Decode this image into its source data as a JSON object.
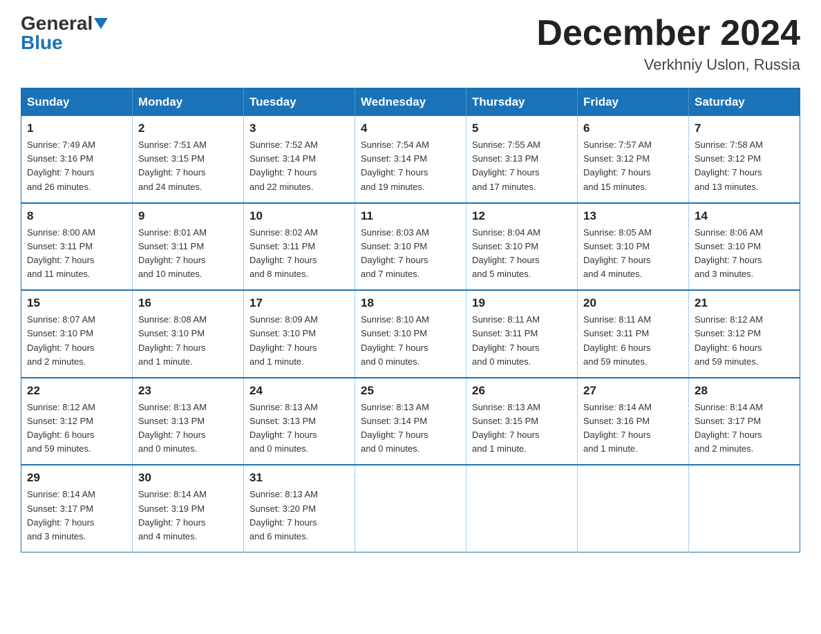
{
  "header": {
    "logo_general": "General",
    "logo_blue": "Blue",
    "month_title": "December 2024",
    "location": "Verkhniy Uslon, Russia"
  },
  "calendar": {
    "days_of_week": [
      "Sunday",
      "Monday",
      "Tuesday",
      "Wednesday",
      "Thursday",
      "Friday",
      "Saturday"
    ],
    "weeks": [
      [
        {
          "day": "1",
          "info": "Sunrise: 7:49 AM\nSunset: 3:16 PM\nDaylight: 7 hours\nand 26 minutes."
        },
        {
          "day": "2",
          "info": "Sunrise: 7:51 AM\nSunset: 3:15 PM\nDaylight: 7 hours\nand 24 minutes."
        },
        {
          "day": "3",
          "info": "Sunrise: 7:52 AM\nSunset: 3:14 PM\nDaylight: 7 hours\nand 22 minutes."
        },
        {
          "day": "4",
          "info": "Sunrise: 7:54 AM\nSunset: 3:14 PM\nDaylight: 7 hours\nand 19 minutes."
        },
        {
          "day": "5",
          "info": "Sunrise: 7:55 AM\nSunset: 3:13 PM\nDaylight: 7 hours\nand 17 minutes."
        },
        {
          "day": "6",
          "info": "Sunrise: 7:57 AM\nSunset: 3:12 PM\nDaylight: 7 hours\nand 15 minutes."
        },
        {
          "day": "7",
          "info": "Sunrise: 7:58 AM\nSunset: 3:12 PM\nDaylight: 7 hours\nand 13 minutes."
        }
      ],
      [
        {
          "day": "8",
          "info": "Sunrise: 8:00 AM\nSunset: 3:11 PM\nDaylight: 7 hours\nand 11 minutes."
        },
        {
          "day": "9",
          "info": "Sunrise: 8:01 AM\nSunset: 3:11 PM\nDaylight: 7 hours\nand 10 minutes."
        },
        {
          "day": "10",
          "info": "Sunrise: 8:02 AM\nSunset: 3:11 PM\nDaylight: 7 hours\nand 8 minutes."
        },
        {
          "day": "11",
          "info": "Sunrise: 8:03 AM\nSunset: 3:10 PM\nDaylight: 7 hours\nand 7 minutes."
        },
        {
          "day": "12",
          "info": "Sunrise: 8:04 AM\nSunset: 3:10 PM\nDaylight: 7 hours\nand 5 minutes."
        },
        {
          "day": "13",
          "info": "Sunrise: 8:05 AM\nSunset: 3:10 PM\nDaylight: 7 hours\nand 4 minutes."
        },
        {
          "day": "14",
          "info": "Sunrise: 8:06 AM\nSunset: 3:10 PM\nDaylight: 7 hours\nand 3 minutes."
        }
      ],
      [
        {
          "day": "15",
          "info": "Sunrise: 8:07 AM\nSunset: 3:10 PM\nDaylight: 7 hours\nand 2 minutes."
        },
        {
          "day": "16",
          "info": "Sunrise: 8:08 AM\nSunset: 3:10 PM\nDaylight: 7 hours\nand 1 minute."
        },
        {
          "day": "17",
          "info": "Sunrise: 8:09 AM\nSunset: 3:10 PM\nDaylight: 7 hours\nand 1 minute."
        },
        {
          "day": "18",
          "info": "Sunrise: 8:10 AM\nSunset: 3:10 PM\nDaylight: 7 hours\nand 0 minutes."
        },
        {
          "day": "19",
          "info": "Sunrise: 8:11 AM\nSunset: 3:11 PM\nDaylight: 7 hours\nand 0 minutes."
        },
        {
          "day": "20",
          "info": "Sunrise: 8:11 AM\nSunset: 3:11 PM\nDaylight: 6 hours\nand 59 minutes."
        },
        {
          "day": "21",
          "info": "Sunrise: 8:12 AM\nSunset: 3:12 PM\nDaylight: 6 hours\nand 59 minutes."
        }
      ],
      [
        {
          "day": "22",
          "info": "Sunrise: 8:12 AM\nSunset: 3:12 PM\nDaylight: 6 hours\nand 59 minutes."
        },
        {
          "day": "23",
          "info": "Sunrise: 8:13 AM\nSunset: 3:13 PM\nDaylight: 7 hours\nand 0 minutes."
        },
        {
          "day": "24",
          "info": "Sunrise: 8:13 AM\nSunset: 3:13 PM\nDaylight: 7 hours\nand 0 minutes."
        },
        {
          "day": "25",
          "info": "Sunrise: 8:13 AM\nSunset: 3:14 PM\nDaylight: 7 hours\nand 0 minutes."
        },
        {
          "day": "26",
          "info": "Sunrise: 8:13 AM\nSunset: 3:15 PM\nDaylight: 7 hours\nand 1 minute."
        },
        {
          "day": "27",
          "info": "Sunrise: 8:14 AM\nSunset: 3:16 PM\nDaylight: 7 hours\nand 1 minute."
        },
        {
          "day": "28",
          "info": "Sunrise: 8:14 AM\nSunset: 3:17 PM\nDaylight: 7 hours\nand 2 minutes."
        }
      ],
      [
        {
          "day": "29",
          "info": "Sunrise: 8:14 AM\nSunset: 3:17 PM\nDaylight: 7 hours\nand 3 minutes."
        },
        {
          "day": "30",
          "info": "Sunrise: 8:14 AM\nSunset: 3:19 PM\nDaylight: 7 hours\nand 4 minutes."
        },
        {
          "day": "31",
          "info": "Sunrise: 8:13 AM\nSunset: 3:20 PM\nDaylight: 7 hours\nand 6 minutes."
        },
        {
          "day": "",
          "info": ""
        },
        {
          "day": "",
          "info": ""
        },
        {
          "day": "",
          "info": ""
        },
        {
          "day": "",
          "info": ""
        }
      ]
    ]
  }
}
